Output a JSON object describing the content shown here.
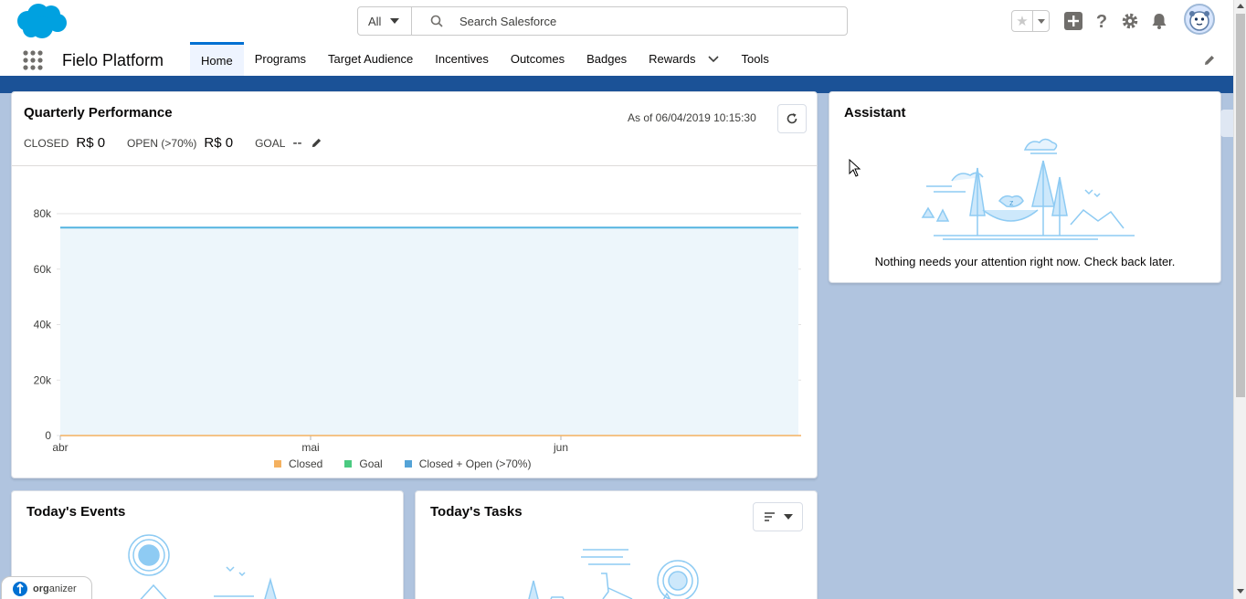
{
  "header": {
    "search_scope": "All",
    "search_placeholder": "Search Salesforce"
  },
  "nav": {
    "app_name": "Fielo Platform",
    "tabs": [
      {
        "label": "Home",
        "active": true
      },
      {
        "label": "Programs"
      },
      {
        "label": "Target Audience"
      },
      {
        "label": "Incentives"
      },
      {
        "label": "Outcomes"
      },
      {
        "label": "Badges"
      },
      {
        "label": "Rewards",
        "has_menu": true
      },
      {
        "label": "Tools"
      }
    ]
  },
  "quarterly": {
    "title": "Quarterly Performance",
    "as_of": "As of 06/04/2019 10:15:30",
    "closed_label": "CLOSED",
    "closed_value": "R$ 0",
    "open_label": "OPEN (>70%)",
    "open_value": "R$ 0",
    "goal_label": "GOAL",
    "goal_value": "--"
  },
  "chart_data": {
    "type": "area",
    "x_ticks": [
      "abr",
      "mai",
      "jun"
    ],
    "y_ticks": [
      "0",
      "20k",
      "40k",
      "60k",
      "80k"
    ],
    "ylim": [
      0,
      80000
    ],
    "series": [
      {
        "name": "Closed",
        "color": "#f4b160",
        "values": [
          0,
          0
        ]
      },
      {
        "name": "Goal",
        "color": "#4bca81",
        "values": [
          75000,
          75000
        ]
      },
      {
        "name": "Closed + Open (>70%)",
        "color": "#54a3d7",
        "values": [
          0,
          0
        ]
      }
    ]
  },
  "assistant": {
    "title": "Assistant",
    "message": "Nothing needs your attention right now. Check back later."
  },
  "events": {
    "title": "Today's Events"
  },
  "tasks": {
    "title": "Today's Tasks"
  },
  "organizer": {
    "prefix": "org",
    "suffix": "anizer"
  }
}
